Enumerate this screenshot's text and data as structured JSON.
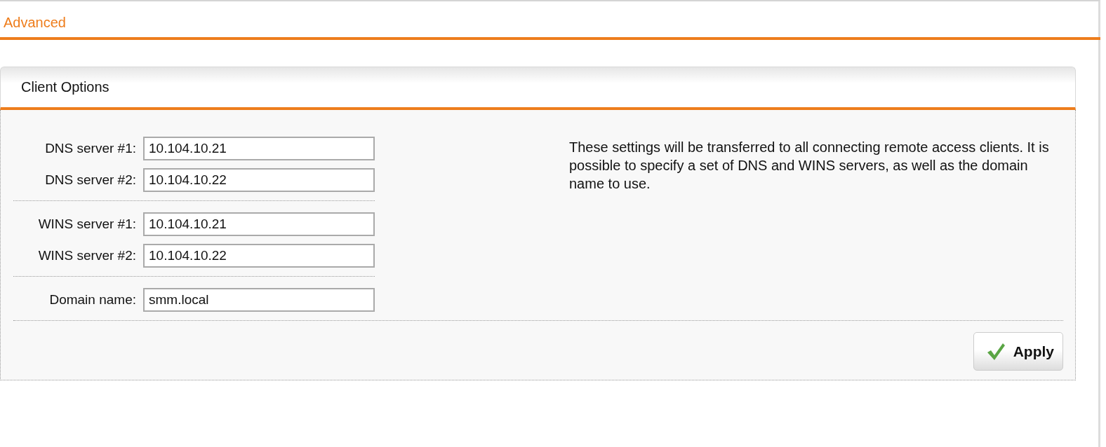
{
  "page": {
    "title": "Advanced"
  },
  "panel": {
    "title": "Client Options",
    "field_groups": [
      {
        "fields": [
          {
            "label": "DNS server #1:",
            "value": "10.104.10.21"
          },
          {
            "label": "DNS server #2:",
            "value": "10.104.10.22"
          }
        ]
      },
      {
        "fields": [
          {
            "label": "WINS server #1:",
            "value": "10.104.10.21"
          },
          {
            "label": "WINS server #2:",
            "value": "10.104.10.22"
          }
        ]
      },
      {
        "fields": [
          {
            "label": "Domain name:",
            "value": "smm.local"
          }
        ]
      }
    ],
    "description": "These settings will be transferred to all connecting remote access clients. It is possible to specify a set of DNS and WINS servers, as well as the domain name to use.",
    "buttons": [
      {
        "label": "Apply"
      }
    ]
  }
}
